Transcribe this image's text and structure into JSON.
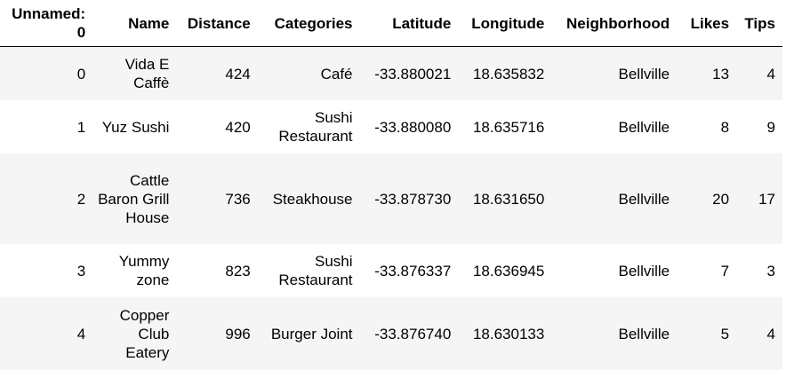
{
  "table": {
    "columns": [
      "Unnamed: 0",
      "Name",
      "Distance",
      "Categories",
      "Latitude",
      "Longitude",
      "Neighborhood",
      "Likes",
      "Tips"
    ],
    "rows": [
      [
        "0",
        "Vida E Caffè",
        "424",
        "Café",
        "-33.880021",
        "18.635832",
        "Bellville",
        "13",
        "4"
      ],
      [
        "1",
        "Yuz Sushi",
        "420",
        "Sushi Restaurant",
        "-33.880080",
        "18.635716",
        "Bellville",
        "8",
        "9"
      ],
      [
        "2",
        "Cattle Baron Grill House",
        "736",
        "Steakhouse",
        "-33.878730",
        "18.631650",
        "Bellville",
        "20",
        "17"
      ],
      [
        "3",
        "Yummy zone",
        "823",
        "Sushi Restaurant",
        "-33.876337",
        "18.636945",
        "Bellville",
        "7",
        "3"
      ],
      [
        "4",
        "Copper Club Eatery",
        "996",
        "Burger Joint",
        "-33.876740",
        "18.630133",
        "Bellville",
        "5",
        "4"
      ]
    ]
  }
}
